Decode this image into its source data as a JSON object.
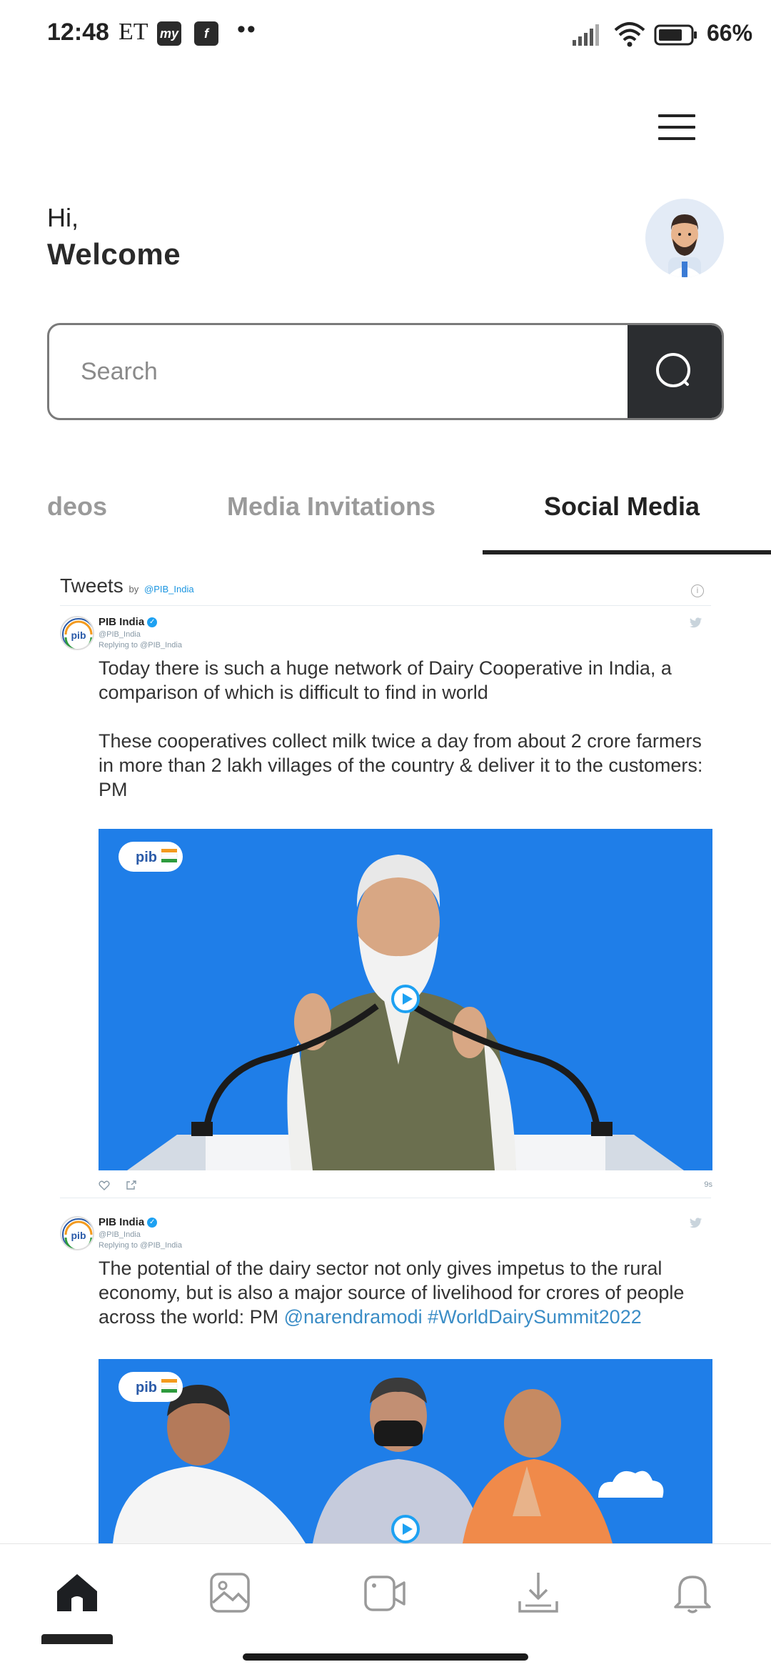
{
  "status_bar": {
    "time": "12:48",
    "carrier": "ET",
    "app_icon_1": "my",
    "app_icon_2": "f",
    "dots": "••",
    "battery": "66%"
  },
  "header": {
    "menu_icon": "hamburger-icon",
    "greeting": "Hi,",
    "welcome": "Welcome"
  },
  "search": {
    "placeholder": "Search",
    "icon": "search-icon"
  },
  "tabs": [
    {
      "label": "deos",
      "active": false
    },
    {
      "label": "Media Invitations",
      "active": false
    },
    {
      "label": "Social Media",
      "active": true
    }
  ],
  "timeline": {
    "title": "Tweets",
    "by": "by",
    "handle": "@PIB_India",
    "tweets": [
      {
        "name": "PIB India",
        "handle": "@PIB_India",
        "reply": "Replying to @PIB_India",
        "text": "Today there is such a huge network of Dairy Cooperative in India, a comparison of which is difficult to find in world\n\nThese cooperatives collect milk twice a day from about 2 crore farmers in more than 2 lakh villages of the country & deliver it to the customers: PM",
        "time": "9s"
      },
      {
        "name": "PIB India",
        "handle": "@PIB_India",
        "reply": "Replying to @PIB_India",
        "text": "The potential of the dairy sector not only gives impetus to the rural economy, but is also a major source of livelihood for crores of people across the world: PM ",
        "mention": "@narendramodi",
        "hashtag": "#WorldDairySummit2022"
      }
    ]
  },
  "bottom_nav": {
    "items": [
      "home-icon",
      "gallery-icon",
      "video-icon",
      "download-icon",
      "bell-icon"
    ],
    "active": "home-icon"
  },
  "colors": {
    "accent_dark": "#2b2d30",
    "twitter_blue": "#1da1f2",
    "media_blue": "#1f7ee8"
  }
}
